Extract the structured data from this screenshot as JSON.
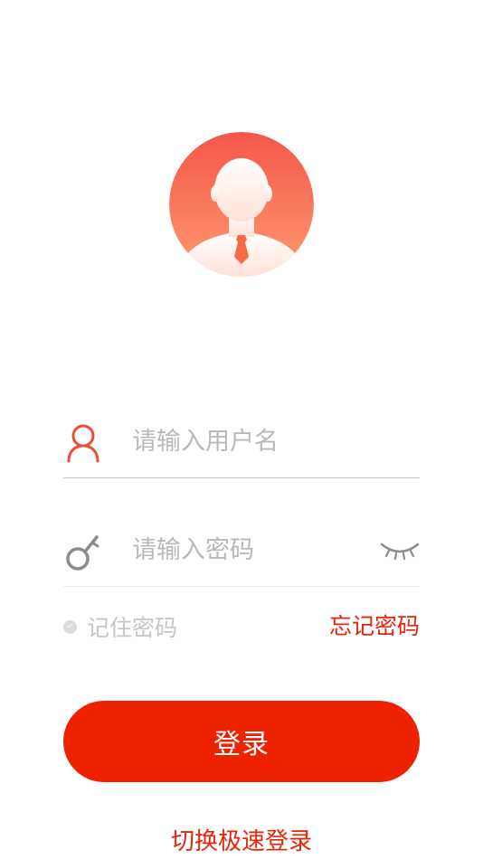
{
  "avatar": {
    "icon": "user-avatar-icon",
    "gradient_top": "#f4574a",
    "gradient_bottom": "#ff9a70"
  },
  "username": {
    "icon": "user-icon",
    "placeholder": "请输入用户名",
    "value": ""
  },
  "password": {
    "icon": "key-icon",
    "placeholder": "请输入密码",
    "value": "",
    "toggle_icon": "eye-closed-icon"
  },
  "remember": {
    "label": "记住密码",
    "checked": false
  },
  "forgot": {
    "label": "忘记密码"
  },
  "login": {
    "label": "登录"
  },
  "switch_mode": {
    "label": "切换极速登录"
  },
  "colors": {
    "accent": "#ef2200",
    "link": "#e8250a",
    "placeholder": "#b9b9b9"
  }
}
